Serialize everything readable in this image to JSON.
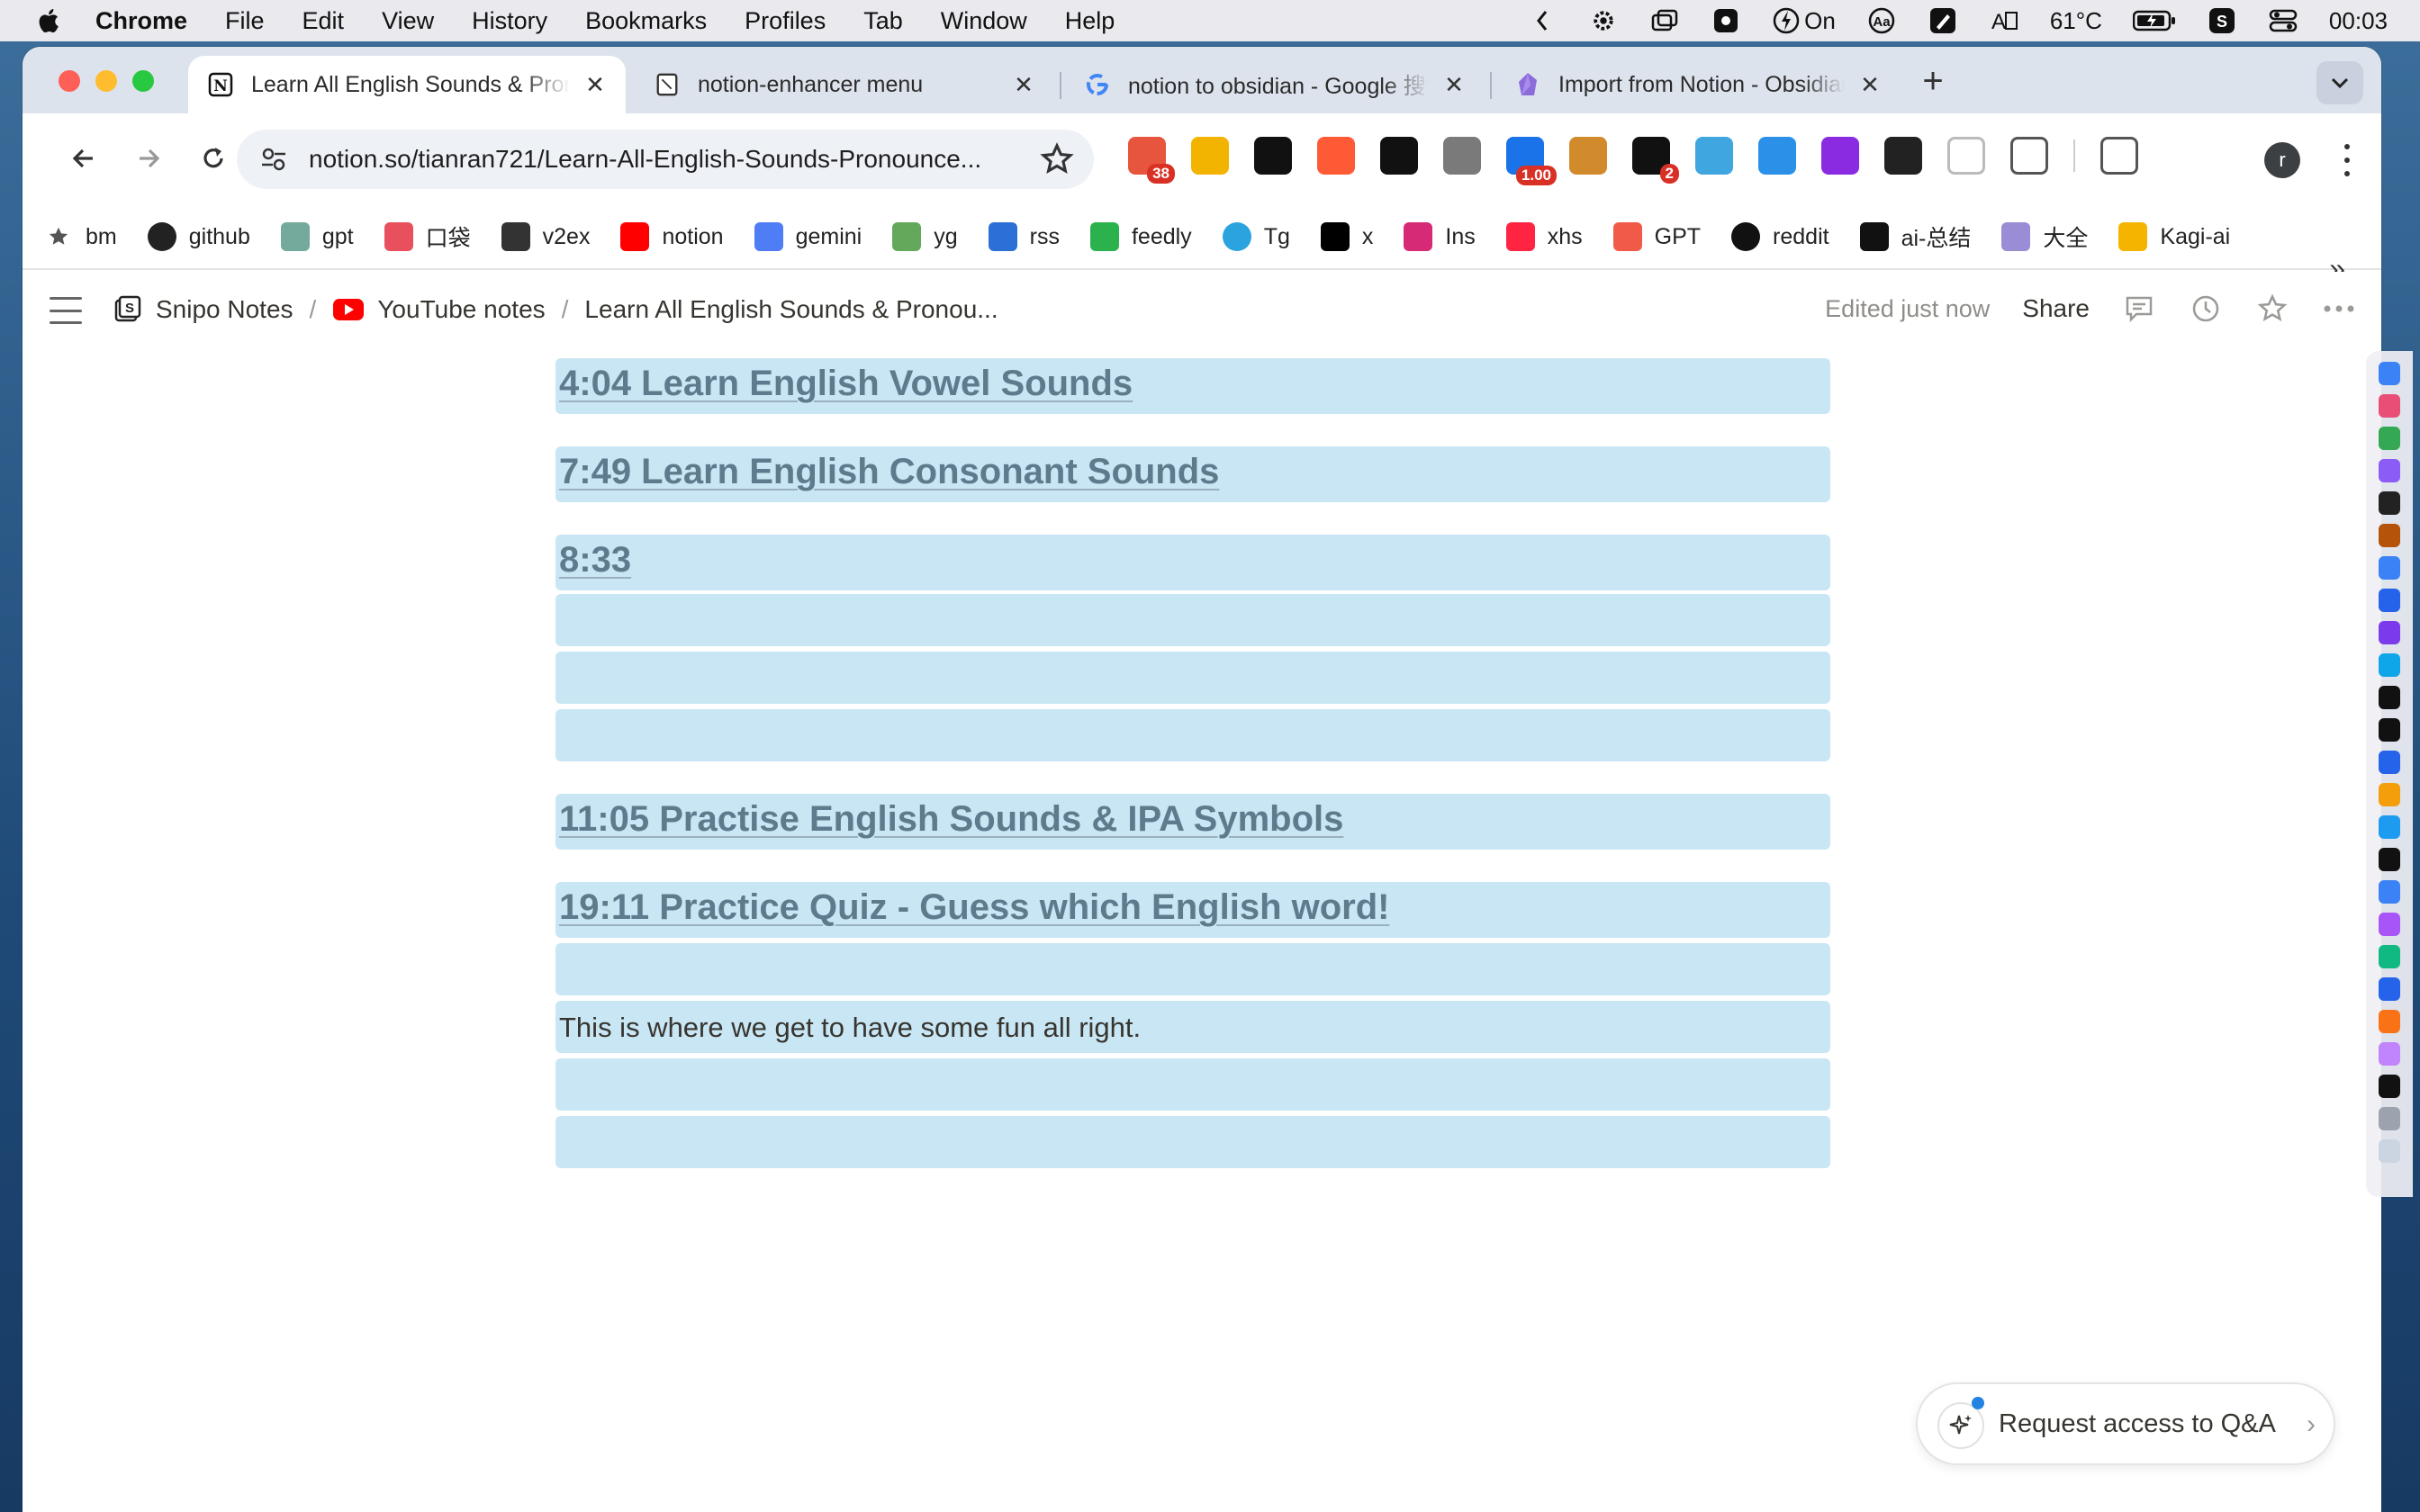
{
  "menubar": {
    "app_name": "Chrome",
    "items": [
      "File",
      "Edit",
      "View",
      "History",
      "Bookmarks",
      "Profiles",
      "Tab",
      "Window",
      "Help"
    ],
    "status": {
      "power_label": "On",
      "temperature": "61°C",
      "clock": "00:03"
    }
  },
  "tabs": [
    {
      "title": "Learn All English Sounds & Pronunciation",
      "icon": "notion-icon",
      "active": true
    },
    {
      "title": "notion-enhancer menu",
      "icon": "notion-icon",
      "active": false
    },
    {
      "title": "notion to obsidian - Google 搜索",
      "icon": "google-icon",
      "active": false
    },
    {
      "title": "Import from Notion - Obsidian",
      "icon": "obsidian-icon",
      "active": false
    }
  ],
  "omnibox": {
    "url": "notion.so/tianran721/Learn-All-English-Sounds-Pronounce..."
  },
  "extensions": [
    {
      "name": "ext-1",
      "color": "#e8553e",
      "badge": "38"
    },
    {
      "name": "ext-2",
      "color": "#f2b400",
      "badge": ""
    },
    {
      "name": "ext-3",
      "color": "#111111",
      "badge": ""
    },
    {
      "name": "ext-4",
      "color": "#ff5a36",
      "badge": ""
    },
    {
      "name": "ext-5",
      "color": "#111111",
      "badge": ""
    },
    {
      "name": "ext-6",
      "color": "#7a7a7a",
      "badge": ""
    },
    {
      "name": "ext-7",
      "color": "#1a73e8",
      "badge": "1.00"
    },
    {
      "name": "ext-8",
      "color": "#d28b2c",
      "badge": ""
    },
    {
      "name": "ext-9",
      "color": "#111111",
      "badge": "2"
    },
    {
      "name": "ext-10",
      "color": "#3fa6e0",
      "badge": ""
    },
    {
      "name": "ext-11",
      "color": "#2b90e8",
      "badge": ""
    },
    {
      "name": "ext-12",
      "color": "#8a2be2",
      "badge": ""
    },
    {
      "name": "ext-13",
      "color": "#222222",
      "badge": ""
    },
    {
      "name": "ext-14",
      "color": "#bbbbbb",
      "badge": ""
    },
    {
      "name": "ext-15",
      "color": "#555555",
      "badge": ""
    },
    {
      "name": "ext-16",
      "color": "#555555",
      "badge": ""
    }
  ],
  "profile_initial": "r",
  "bookmarks": [
    {
      "label": "bm",
      "color": "#555555"
    },
    {
      "label": "github",
      "color": "#222222"
    },
    {
      "label": "gpt",
      "color": "#74aa9c"
    },
    {
      "label": "口袋",
      "color": "#e9505e"
    },
    {
      "label": "v2ex",
      "color": "#333333"
    },
    {
      "label": "notion",
      "color": "#ff0000"
    },
    {
      "label": "gemini",
      "color": "#4f7df5"
    },
    {
      "label": "yg",
      "color": "#64a85b"
    },
    {
      "label": "rss",
      "color": "#2c6fd6"
    },
    {
      "label": "feedly",
      "color": "#2bb24c"
    },
    {
      "label": "Tg",
      "color": "#2aa3df"
    },
    {
      "label": "x",
      "color": "#000000"
    },
    {
      "label": "Ins",
      "color": "#d62976"
    },
    {
      "label": "xhs",
      "color": "#ff2442"
    },
    {
      "label": "GPT",
      "color": "#f15a48"
    },
    {
      "label": "reddit",
      "color": "#111111"
    },
    {
      "label": "ai-总结",
      "color": "#111111"
    },
    {
      "label": "大全",
      "color": "#9b8cd6"
    },
    {
      "label": "Kagi-ai",
      "color": "#f4b400"
    }
  ],
  "notion": {
    "breadcrumbs": [
      "Snipo Notes",
      "YouTube notes",
      "Learn All English Sounds & Pronou..."
    ],
    "edited": "Edited just now",
    "share": "Share",
    "blocks": [
      {
        "kind": "heading",
        "text": "4:04 Learn English Vowel Sounds"
      },
      {
        "kind": "heading",
        "text": "7:49 Learn English Consonant Sounds"
      },
      {
        "kind": "heading",
        "text": "8:33"
      },
      {
        "kind": "empty",
        "text": ""
      },
      {
        "kind": "empty",
        "text": ""
      },
      {
        "kind": "empty",
        "text": ""
      },
      {
        "kind": "heading",
        "text": "11:05 Practise English Sounds & IPA Symbols"
      },
      {
        "kind": "heading",
        "text": "19:11 Practice Quiz - Guess which English word!"
      },
      {
        "kind": "empty",
        "text": ""
      },
      {
        "kind": "para",
        "text": "This is where we get to have some fun all right."
      },
      {
        "kind": "empty",
        "text": ""
      },
      {
        "kind": "empty",
        "text": ""
      }
    ],
    "qa_button": "Request access to Q&A",
    "highlight_color": "#c9e6f4"
  },
  "dock_apps": [
    "#3b82f6",
    "#e94e77",
    "#34a853",
    "#8b5cf6",
    "#222222",
    "#b45309",
    "#3b82f6",
    "#2563eb",
    "#7c3aed",
    "#0ea5e9",
    "#111111",
    "#111111",
    "#2563eb",
    "#f59e0b",
    "#1d9bf0",
    "#111111",
    "#3b82f6",
    "#a855f7",
    "#10b981",
    "#2563eb",
    "#f97316",
    "#c084fc",
    "#111111",
    "#9ca3af",
    "#cbd5e1"
  ]
}
